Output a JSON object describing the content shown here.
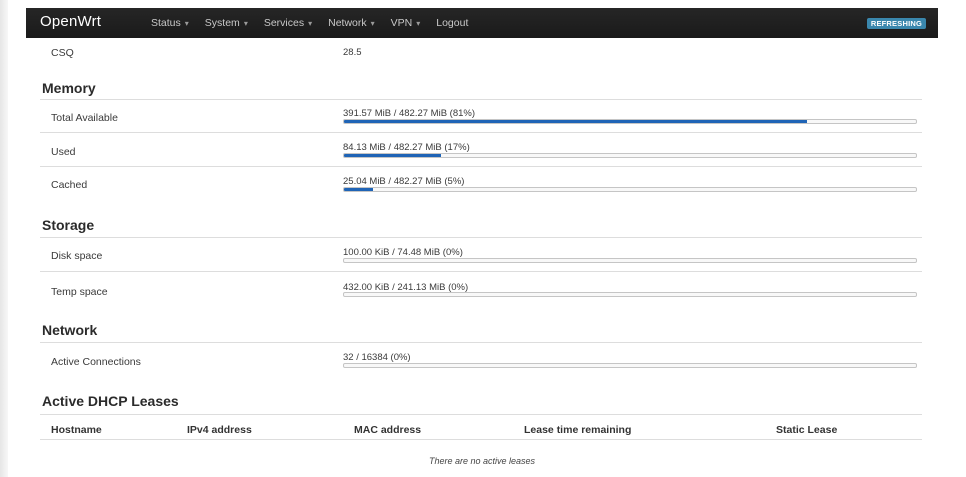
{
  "navbar": {
    "brand": "OpenWrt",
    "menu": [
      {
        "label": "Status",
        "dropdown": true
      },
      {
        "label": "System",
        "dropdown": true
      },
      {
        "label": "Services",
        "dropdown": true
      },
      {
        "label": "Network",
        "dropdown": true
      },
      {
        "label": "VPN",
        "dropdown": true
      },
      {
        "label": "Logout",
        "dropdown": false
      }
    ],
    "badge": "REFRESHING",
    "badge_color": "#3a87ad"
  },
  "csq": {
    "label": "CSQ",
    "value": "28.5"
  },
  "memory": {
    "title": "Memory",
    "rows": [
      {
        "label": "Total Available",
        "value": "391.57 MiB / 482.27 MiB (81%)",
        "percent": 81
      },
      {
        "label": "Used",
        "value": "84.13 MiB / 482.27 MiB (17%)",
        "percent": 17
      },
      {
        "label": "Cached",
        "value": "25.04 MiB / 482.27 MiB (5%)",
        "percent": 5
      }
    ]
  },
  "storage": {
    "title": "Storage",
    "rows": [
      {
        "label": "Disk space",
        "value": "100.00 KiB / 74.48 MiB (0%)",
        "percent": 0
      },
      {
        "label": "Temp space",
        "value": "432.00 KiB / 241.13 MiB (0%)",
        "percent": 0
      }
    ]
  },
  "network": {
    "title": "Network",
    "rows": [
      {
        "label": "Active Connections",
        "value": "32 / 16384 (0%)",
        "percent": 0
      }
    ]
  },
  "dhcp": {
    "title": "Active DHCP Leases",
    "columns": [
      "Hostname",
      "IPv4 address",
      "MAC address",
      "Lease time remaining",
      "Static Lease"
    ],
    "empty": "There are no active leases"
  },
  "colors": {
    "bar": "#1f64b6",
    "navbar": "#1f1f1f"
  }
}
